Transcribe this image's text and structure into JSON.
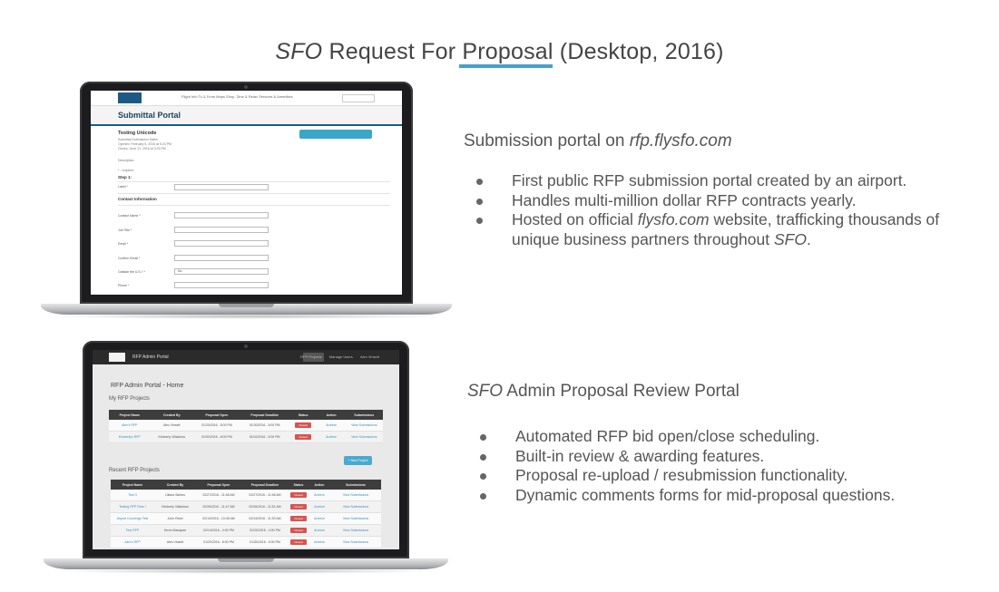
{
  "title": {
    "italic": "SFO",
    "rest": " Request For Proposal (Desktop, 2016)"
  },
  "accent_color": "#4a9fc7",
  "section1": {
    "heading_prefix": "Submission portal on ",
    "heading_italic": "rfp.flysfo.com",
    "bullets": [
      {
        "text": "First public RFP submission portal created by an airport."
      },
      {
        "text": "Handles multi-million dollar RFP contracts yearly."
      },
      {
        "pre": "Hosted on official ",
        "italic": "flysfo.com",
        "mid": " website, trafficking thousands of unique business partners throughout ",
        "italic2": "SFO",
        "post": "."
      }
    ]
  },
  "section2": {
    "heading_italic": "SFO",
    "heading_rest": " Admin Proposal Review Portal",
    "bullets": [
      "Automated RFP bid open/close scheduling.",
      "Built-in review & awarding features.",
      "Proposal re-upload / resubmission functionality.",
      "Dynamic comments forms for mid-proposal questions."
    ]
  },
  "screen1": {
    "nav": "Flight Info    To & From    Maps    Shop, Dine & Relax    Services & Amenities",
    "page_title": "Submittal Portal",
    "project_title": "Testing Unicode",
    "submission_date_label": "Submittal Submission Dates",
    "opened": "Opened: February 5, 2016 at 5:23 PM",
    "closes": "Closes: June 21, 2016 at 3:23 PM",
    "description_label": "Description",
    "required_label": "* - required",
    "step": "Step 1:",
    "label_field": "Label *",
    "contact_heading": "Contact Information",
    "fields": [
      "Contact Name *",
      "Job Title *",
      "Email *",
      "Confirm Email *",
      "Outside the U.S.? *",
      "Phone *"
    ],
    "outside_value": "No"
  },
  "screen2": {
    "brand": "RFP Admin Portal",
    "nav": [
      "RFP Projects",
      "Manage Users",
      "Alex Vinsett"
    ],
    "page_title": "RFP Admin Portal - Home",
    "my_projects_heading": "My RFP Projects",
    "recent_projects_heading": "Recent RFP Projects",
    "new_project_button": "+ New Project",
    "columns": [
      "Project Name",
      "Created By",
      "Proposal Open",
      "Proposal Deadline",
      "Status",
      "Action",
      "Submissions"
    ],
    "my_projects": [
      [
        "Alex's RFP",
        "Alex Vinsett",
        "01/20/2016 - 8:00 PM",
        "01/30/2016 - 5:00 PM",
        "Closed",
        "Archive",
        "View Submissions"
      ],
      [
        "Kimberly's RFP",
        "Kimberly Villalobos",
        "01/02/2016 - 8:00 PM",
        "01/02/2016 - 5:00 PM",
        "Closed",
        "Archive",
        "View Submissions"
      ]
    ],
    "recent_projects": [
      [
        "Test 3",
        "Liliana Santos",
        "02/27/2016 - 11:48 AM",
        "02/27/2016 - 11:48 AM",
        "Closed",
        "Archive",
        "View Submissions"
      ],
      [
        "Testing RFP Fees !",
        "Kimberly Villalobos",
        "02/26/2016 - 11:47 AM",
        "02/26/2016 - 11:51 AM",
        "Closed",
        "Archive",
        "View Submissions"
      ],
      [
        "Airport Concierge Test",
        "John Reed",
        "02/14/2016 - 10:45 AM",
        "02/14/2016 - 11:30 AM",
        "Closed",
        "Archive",
        "View Submissions"
      ],
      [
        "Test RFP",
        "Kevin Manapan",
        "02/14/2016 - 4:00 PM",
        "02/20/2016 - 4:00 PM",
        "Closed",
        "Archive",
        "View Submissions"
      ],
      [
        "Alex's RFP",
        "Alex Vinsett",
        "01/20/2016 - 8:00 PM",
        "01/30/2016 - 5:00 PM",
        "Closed",
        "Archive",
        "View Submissions"
      ]
    ]
  }
}
